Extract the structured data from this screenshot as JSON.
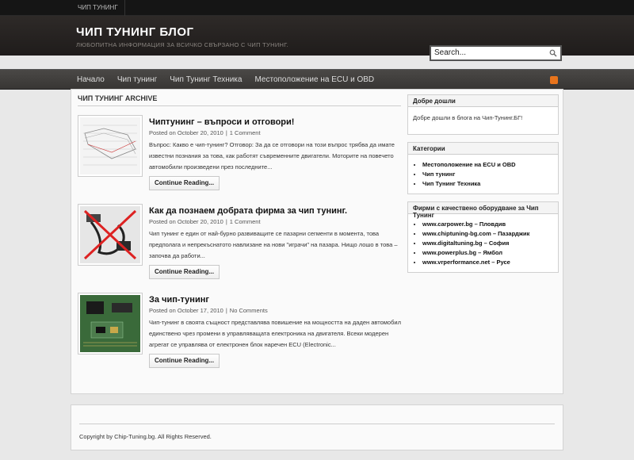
{
  "topbar": {
    "link": "ЧИП ТУНИНГ"
  },
  "header": {
    "title": "ЧИП ТУНИНГ БЛОГ",
    "description": "ЛЮБОПИТНА ИНФОРМАЦИЯ ЗА ВСИЧКО СВЪРЗАНО С ЧИП ТУНИНГ.",
    "search_value": "Search..."
  },
  "nav": {
    "items": [
      "Начало",
      "Чип тунинг",
      "Чип Тунинг Техника",
      "Местоположение на ECU и OBD"
    ]
  },
  "main": {
    "archive_title": "ЧИП ТУНИНГ ARCHIVE",
    "posts": [
      {
        "title": "Чиптунинг – въпроси и отговори!",
        "date": "Posted on October 20, 2010",
        "comments": "1 Comment",
        "excerpt": "Въпрос: Какво е чип-тунинг? Отговор: За да се отговори на този въпрос трябва да имате известни познания за това, как работят съвременните двигатели. Моторите на повечето автомобили произведени през последните...",
        "button": "Continue Reading..."
      },
      {
        "title": "Как да познаем добрата фирма за чип тунинг.",
        "date": "Posted on October 20, 2010",
        "comments": "1 Comment",
        "excerpt": "Чип тунинг е един от най-бурно развиващите се пазарни сегменти в момента, това предполага и непрекъснатото навлизане на нови \"играчи\" на пазара. Нищо лошо в това – започва да работи...",
        "button": "Continue Reading..."
      },
      {
        "title": "За чип-тунинг",
        "date": "Posted on October 17, 2010",
        "comments": "No Comments",
        "excerpt": "Чип-тунинг в своята същност представлява повишение на мощността на даден автомобил единствено чрез промени в управляващата електроника на двигателя. Всеки модерен агрегат се управлява от електронен блок наречен ECU (Electronic...",
        "button": "Continue Reading..."
      }
    ]
  },
  "sidebar": {
    "welcome": {
      "title": "Добре дошли",
      "text": "Добре дошли в блога на Чип-Тунинг.БГ!"
    },
    "categories": {
      "title": "Категории",
      "items": [
        "Местоположение на ECU и OBD",
        "Чип тунинг",
        "Чип Тунинг Техника"
      ]
    },
    "firms": {
      "title": "Фирми с качествено оборудване за Чип Тунинг",
      "items": [
        "www.carpower.bg – Пловдив",
        "www.chiptuning-bg.com – Пазарджик",
        "www.digitaltuning.bg – София",
        "www.powerplus.bg – Ямбол",
        "www.vrperformance.net – Русе"
      ]
    }
  },
  "footer": {
    "copyright": "Copyright by Chip-Tuning.bg. All Rights Reserved."
  },
  "colors": {
    "rss": "#e8741c",
    "header_bg": "#2e2a28",
    "nav_bg": "#4a4846"
  }
}
